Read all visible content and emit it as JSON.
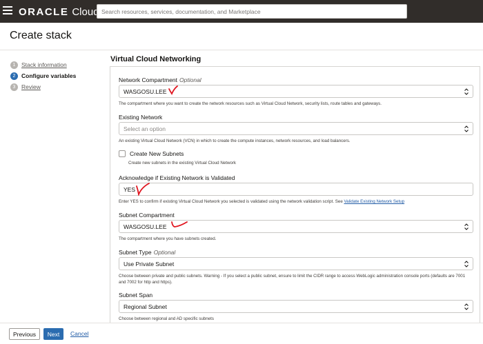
{
  "topbar": {
    "brand_primary": "ORACLE",
    "brand_secondary": "Cloud",
    "search_placeholder": "Search resources, services, documentation, and Marketplace"
  },
  "page": {
    "title": "Create stack"
  },
  "steps": [
    {
      "number": "1",
      "label": "Stack information",
      "state": "done"
    },
    {
      "number": "2",
      "label": "Configure variables",
      "state": "current"
    },
    {
      "number": "3",
      "label": "Review",
      "state": "pending"
    }
  ],
  "section": {
    "title": "Virtual Cloud Networking"
  },
  "fields": {
    "network_compartment": {
      "label": "Network Compartment",
      "optional": "Optional",
      "value": "WASGOSU.LEE",
      "help": "The compartment where you want to create the network resources such as Virtual Cloud Network, security lists, route tables and gateways."
    },
    "existing_network": {
      "label": "Existing Network",
      "placeholder": "Select an option",
      "help": "An existing Virtual Cloud Network (VCN) in which to create the compute instances, network resources, and load balancers."
    },
    "create_new_subnets": {
      "label": "Create New Subnets",
      "checked": false,
      "help": "Create new subnets in the existing Virtual Cloud Network"
    },
    "acknowledge": {
      "label": "Acknowledge if Existing Network is Validated",
      "value": "YES",
      "help": "Enter YES to confirm if existing Virtual Cloud Network you selected is validated using the network validation script. See",
      "help_link": "Validate Existing Network Setup"
    },
    "subnet_compartment": {
      "label": "Subnet Compartment",
      "value": "WASGOSU.LEE",
      "help": "The compartment where you have subnets created."
    },
    "subnet_type": {
      "label": "Subnet Type",
      "optional": "Optional",
      "value": "Use Private Subnet",
      "help": "Choose between private and public subnets. Warning - If you select a public subnet, ensure to limit the CIDR range to access WebLogic administration console ports (defaults are 7001 and 7002 for http and https)."
    },
    "subnet_span": {
      "label": "Subnet Span",
      "value": "Regional Subnet",
      "help": "Choose between regional and AD specific subnets"
    }
  },
  "footer": {
    "previous_label": "Previous",
    "next_label": "Next",
    "cancel_label": "Cancel"
  },
  "colors": {
    "topbar": "#312d2a",
    "primary": "#2b6cb0",
    "link": "#1f5aa5",
    "annotation": "#e0141e"
  }
}
